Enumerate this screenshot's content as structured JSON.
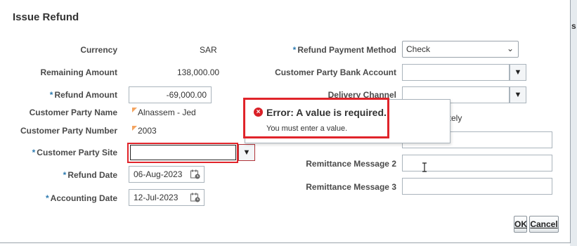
{
  "dialog": {
    "title": "Issue Refund"
  },
  "left": {
    "currency_label": "Currency",
    "currency_value": "SAR",
    "remaining_label": "Remaining Amount",
    "remaining_value": "138,000.00",
    "refund_amount_label": "Refund Amount",
    "refund_amount_value": "-69,000.00",
    "party_name_label": "Customer Party Name",
    "party_name_value": "Alnassem - Jed",
    "party_number_label": "Customer Party Number",
    "party_number_value": "2003",
    "party_site_label": "Customer Party Site",
    "party_site_value": "",
    "refund_date_label": "Refund Date",
    "refund_date_value": "06-Aug-2023",
    "accounting_date_label": "Accounting Date",
    "accounting_date_value": "12-Jul-2023"
  },
  "right": {
    "payment_method_label": "Refund Payment Method",
    "payment_method_value": "Check",
    "bank_account_label": "Customer Party Bank Account",
    "bank_account_value": "",
    "delivery_channel_label": "Delivery Channel",
    "delivery_channel_value": "",
    "partial_text": "ately",
    "remittance2_label": "Remittance Message 2",
    "remittance3_label": "Remittance Message 3"
  },
  "error_popup": {
    "title": "Error: A value is required.",
    "message": "You must enter a value."
  },
  "buttons": {
    "ok": "OK",
    "cancel": "Cancel"
  },
  "required_marker": "*",
  "colors": {
    "error": "#e0242a",
    "required": "#2e7bb0"
  }
}
